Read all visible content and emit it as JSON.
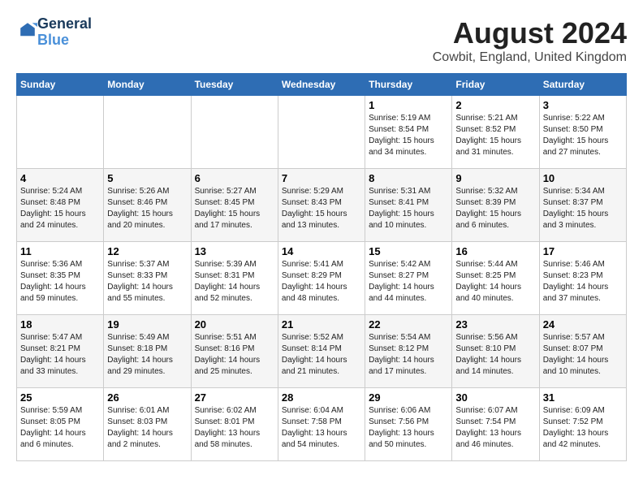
{
  "logo": {
    "line1": "General",
    "line2": "Blue"
  },
  "title": "August 2024",
  "subtitle": "Cowbit, England, United Kingdom",
  "weekdays": [
    "Sunday",
    "Monday",
    "Tuesday",
    "Wednesday",
    "Thursday",
    "Friday",
    "Saturday"
  ],
  "weeks": [
    [
      {
        "day": "",
        "info": ""
      },
      {
        "day": "",
        "info": ""
      },
      {
        "day": "",
        "info": ""
      },
      {
        "day": "",
        "info": ""
      },
      {
        "day": "1",
        "info": "Sunrise: 5:19 AM\nSunset: 8:54 PM\nDaylight: 15 hours\nand 34 minutes."
      },
      {
        "day": "2",
        "info": "Sunrise: 5:21 AM\nSunset: 8:52 PM\nDaylight: 15 hours\nand 31 minutes."
      },
      {
        "day": "3",
        "info": "Sunrise: 5:22 AM\nSunset: 8:50 PM\nDaylight: 15 hours\nand 27 minutes."
      }
    ],
    [
      {
        "day": "4",
        "info": "Sunrise: 5:24 AM\nSunset: 8:48 PM\nDaylight: 15 hours\nand 24 minutes."
      },
      {
        "day": "5",
        "info": "Sunrise: 5:26 AM\nSunset: 8:46 PM\nDaylight: 15 hours\nand 20 minutes."
      },
      {
        "day": "6",
        "info": "Sunrise: 5:27 AM\nSunset: 8:45 PM\nDaylight: 15 hours\nand 17 minutes."
      },
      {
        "day": "7",
        "info": "Sunrise: 5:29 AM\nSunset: 8:43 PM\nDaylight: 15 hours\nand 13 minutes."
      },
      {
        "day": "8",
        "info": "Sunrise: 5:31 AM\nSunset: 8:41 PM\nDaylight: 15 hours\nand 10 minutes."
      },
      {
        "day": "9",
        "info": "Sunrise: 5:32 AM\nSunset: 8:39 PM\nDaylight: 15 hours\nand 6 minutes."
      },
      {
        "day": "10",
        "info": "Sunrise: 5:34 AM\nSunset: 8:37 PM\nDaylight: 15 hours\nand 3 minutes."
      }
    ],
    [
      {
        "day": "11",
        "info": "Sunrise: 5:36 AM\nSunset: 8:35 PM\nDaylight: 14 hours\nand 59 minutes."
      },
      {
        "day": "12",
        "info": "Sunrise: 5:37 AM\nSunset: 8:33 PM\nDaylight: 14 hours\nand 55 minutes."
      },
      {
        "day": "13",
        "info": "Sunrise: 5:39 AM\nSunset: 8:31 PM\nDaylight: 14 hours\nand 52 minutes."
      },
      {
        "day": "14",
        "info": "Sunrise: 5:41 AM\nSunset: 8:29 PM\nDaylight: 14 hours\nand 48 minutes."
      },
      {
        "day": "15",
        "info": "Sunrise: 5:42 AM\nSunset: 8:27 PM\nDaylight: 14 hours\nand 44 minutes."
      },
      {
        "day": "16",
        "info": "Sunrise: 5:44 AM\nSunset: 8:25 PM\nDaylight: 14 hours\nand 40 minutes."
      },
      {
        "day": "17",
        "info": "Sunrise: 5:46 AM\nSunset: 8:23 PM\nDaylight: 14 hours\nand 37 minutes."
      }
    ],
    [
      {
        "day": "18",
        "info": "Sunrise: 5:47 AM\nSunset: 8:21 PM\nDaylight: 14 hours\nand 33 minutes."
      },
      {
        "day": "19",
        "info": "Sunrise: 5:49 AM\nSunset: 8:18 PM\nDaylight: 14 hours\nand 29 minutes."
      },
      {
        "day": "20",
        "info": "Sunrise: 5:51 AM\nSunset: 8:16 PM\nDaylight: 14 hours\nand 25 minutes."
      },
      {
        "day": "21",
        "info": "Sunrise: 5:52 AM\nSunset: 8:14 PM\nDaylight: 14 hours\nand 21 minutes."
      },
      {
        "day": "22",
        "info": "Sunrise: 5:54 AM\nSunset: 8:12 PM\nDaylight: 14 hours\nand 17 minutes."
      },
      {
        "day": "23",
        "info": "Sunrise: 5:56 AM\nSunset: 8:10 PM\nDaylight: 14 hours\nand 14 minutes."
      },
      {
        "day": "24",
        "info": "Sunrise: 5:57 AM\nSunset: 8:07 PM\nDaylight: 14 hours\nand 10 minutes."
      }
    ],
    [
      {
        "day": "25",
        "info": "Sunrise: 5:59 AM\nSunset: 8:05 PM\nDaylight: 14 hours\nand 6 minutes."
      },
      {
        "day": "26",
        "info": "Sunrise: 6:01 AM\nSunset: 8:03 PM\nDaylight: 14 hours\nand 2 minutes."
      },
      {
        "day": "27",
        "info": "Sunrise: 6:02 AM\nSunset: 8:01 PM\nDaylight: 13 hours\nand 58 minutes."
      },
      {
        "day": "28",
        "info": "Sunrise: 6:04 AM\nSunset: 7:58 PM\nDaylight: 13 hours\nand 54 minutes."
      },
      {
        "day": "29",
        "info": "Sunrise: 6:06 AM\nSunset: 7:56 PM\nDaylight: 13 hours\nand 50 minutes."
      },
      {
        "day": "30",
        "info": "Sunrise: 6:07 AM\nSunset: 7:54 PM\nDaylight: 13 hours\nand 46 minutes."
      },
      {
        "day": "31",
        "info": "Sunrise: 6:09 AM\nSunset: 7:52 PM\nDaylight: 13 hours\nand 42 minutes."
      }
    ]
  ]
}
